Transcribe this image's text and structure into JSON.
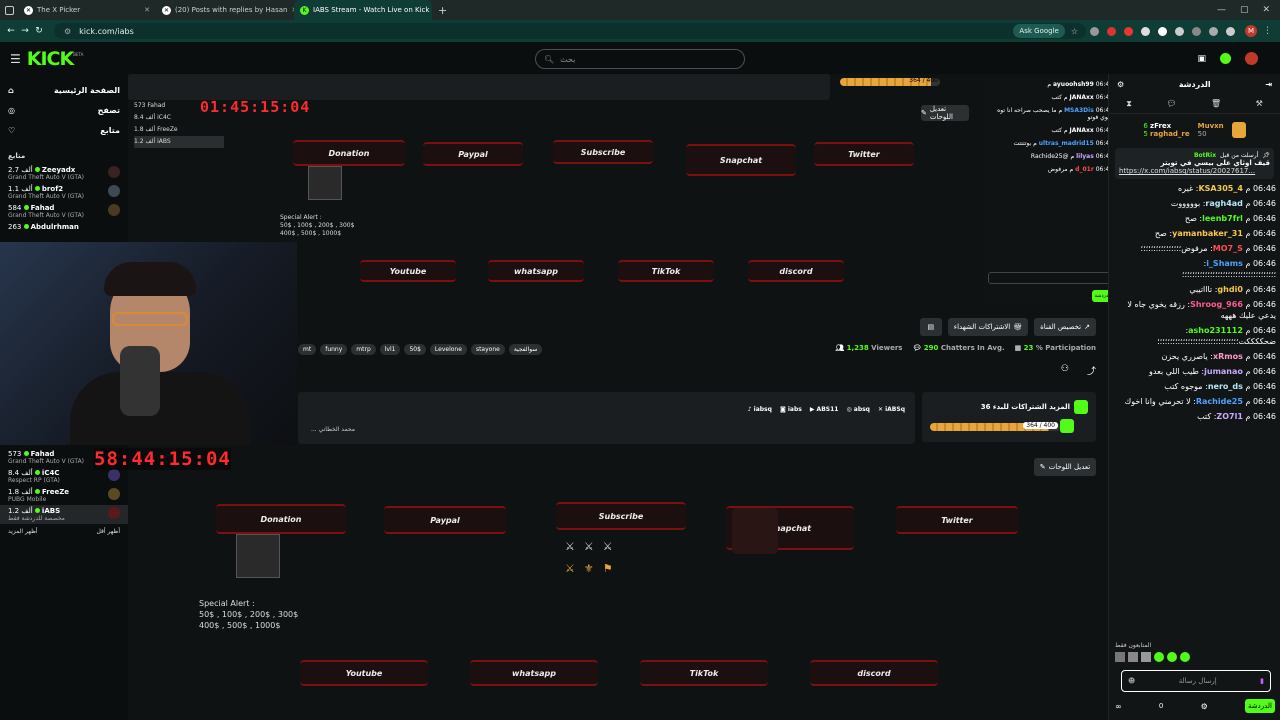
{
  "browser": {
    "tabs": [
      {
        "title": "The X Picker",
        "icon": "x-logo-icon"
      },
      {
        "title": "(20) Posts with replies by Hasan",
        "icon": "x-logo-icon"
      },
      {
        "title": "IABS Stream - Watch Live on Kick",
        "icon": "kick-icon"
      }
    ],
    "new_tab": "+",
    "url": "kick.com/iabs",
    "ask_google": "Ask Google",
    "profile_initial": "M"
  },
  "header": {
    "logo": "KICK",
    "beta": "BETA",
    "search_placeholder": "بحث"
  },
  "sidebar": {
    "nav": [
      {
        "label": "الصفحة الرئيسية",
        "icon": "home-icon"
      },
      {
        "label": "تصفح",
        "icon": "compass-icon"
      },
      {
        "label": "متابع",
        "icon": "heart-icon"
      }
    ],
    "following_heading": "متابع",
    "channels": [
      {
        "name": "Zeeyadx",
        "viewers": "2.7 ألف",
        "game": "Grand Theft Auto V (GTA)"
      },
      {
        "name": "brof2",
        "viewers": "1.1 ألف",
        "game": "Grand Theft Auto V (GTA)"
      },
      {
        "name": "Fahad",
        "viewers": "584",
        "game": "Grand Theft Auto V (GTA)"
      },
      {
        "name": "Abdulrhman",
        "viewers": "263",
        "game": ""
      }
    ],
    "channels_lower": [
      {
        "name": "Fahad",
        "viewers": "573",
        "game": "Grand Theft Auto V (GTA)"
      },
      {
        "name": "iC4C",
        "viewers": "8.4 ألف",
        "game": "Respect RP (GTA)"
      },
      {
        "name": "FreeZe",
        "viewers": "1.8 ألف",
        "game": "PUBG Mobile"
      },
      {
        "name": "iABS",
        "viewers": "1.2 ألف",
        "game": "مخصصة للدردشة فقط"
      }
    ],
    "show_more": "أظهر المزيد",
    "show_less": "أظهر أقل"
  },
  "stream": {
    "timer_top": "01:45:15:04",
    "timer_bottom": "58:44:15:04",
    "top_socials": [
      "Donation",
      "Paypal",
      "Subscribe",
      "Snapchat",
      "Twitter"
    ],
    "bottom_socials": [
      "Youtube",
      "whatsapp",
      "TikTok",
      "discord"
    ],
    "special_alert_title": "Special Alert :",
    "special_alert_line1": "50$ , 100$ , 200$ , 300$",
    "special_alert_line2": "400$ , 500$ , 1000$",
    "edit_panels": "تعديل اللوحات",
    "tags": [
      "mt",
      "funny",
      "mtrp",
      "lvl1",
      "50$",
      "Levelone",
      "stayone",
      "سوالفجية"
    ],
    "viewers_count": "1,238",
    "viewers_label": "Viewers",
    "chatters_count": "290",
    "chatters_label": "Chatters In Avg.",
    "participation": "23",
    "participation_label": "% Participation",
    "customize_button": "تخصيص القناة",
    "subscriptions_button": "الاشتراكات الشهداء",
    "links": [
      "iABSq",
      "absq",
      "ABS11",
      "iabs",
      "iabsq"
    ],
    "bio_text": "... محمد الخطاني",
    "sub_goal_title": "المزيد الشتراكات للبدء 36",
    "sub_goal_progress": "364 / 400",
    "sub_goal_fraction": 0.91
  },
  "chat": {
    "title": "الدردشة",
    "leaderboard": [
      {
        "name": "Muvxn",
        "points": "50"
      },
      {
        "name": "zFrex",
        "points": "6"
      },
      {
        "name": "raghad_re",
        "points": "5"
      }
    ],
    "pinned_author": "BotRix",
    "pinned_label": "أرسلت من قبل",
    "pinned_text": "قيف اوثاي على بيسي في تويتر",
    "pinned_link": "https://x.com/iabsq/status/20027617...",
    "messages": [
      {
        "time": "06:46 م",
        "user": "KSA305_4",
        "text": "غيره",
        "color": "#f7c948"
      },
      {
        "time": "06:46 م",
        "user": "ragh4ad",
        "text": "بوووووت",
        "color": "#b5e8f7"
      },
      {
        "time": "06:46 م",
        "user": "leenb7frl",
        "text": "صح",
        "color": "#53fc18"
      },
      {
        "time": "06:46 م",
        "user": "yamanbaker_31",
        "text": "صح",
        "color": "#f7c948"
      },
      {
        "time": "06:46 م",
        "user": "MO7_S",
        "text": "مرفوض؛؛؛؛؛؛؛؛؛؛؛؛؛؛؛؛",
        "color": "#ff4d4d"
      },
      {
        "time": "06:46 م",
        "user": "i_Shams",
        "text": "؛؛؛؛؛؛؛؛؛؛؛؛؛؛؛؛؛؛؛؛؛؛؛؛؛؛؛؛؛؛؛؛؛؛؛؛؛",
        "color": "#4da3ff"
      },
      {
        "time": "06:46 م",
        "user": "ghdi0",
        "text": "تاااتيبي",
        "color": "#f7c948"
      },
      {
        "time": "06:46 م",
        "user": "Shroog_966",
        "text": "رزقه يخوي جاه لا يدعي عليك هههه",
        "color": "#ff5c8a"
      },
      {
        "time": "06:46 م",
        "user": "asho231112",
        "text": "ضحككككت؛؛؛؛؛؛؛؛؛؛؛؛؛؛؛؛؛؛؛؛؛؛؛؛؛؛؛؛؛؛؛؛",
        "color": "#53fc18"
      },
      {
        "time": "06:46 م",
        "user": "xRmos",
        "text": "ياصرري يحزن",
        "color": "#ff99cc"
      },
      {
        "time": "06:46 م",
        "user": "jumanao",
        "text": "طيب اللي بعدو",
        "color": "#c9a8ff"
      },
      {
        "time": "06:46 م",
        "user": "nero_ds",
        "text": "موجوه كتب",
        "color": "#b5e8f7"
      },
      {
        "time": "06:46 م",
        "user": "Rachide25",
        "text": "لا تحرمني وانا اخوك",
        "color": "#4da3ff"
      },
      {
        "time": "06:46 م",
        "user": "ZO7l1",
        "text": "كتب",
        "color": "#c9a8ff"
      }
    ],
    "mini_messages": [
      {
        "time": "06:46 م",
        "user": "ayuoohsh99",
        "text": ""
      },
      {
        "time": "06:46 م",
        "user": "JANAxx",
        "text": "كتب"
      },
      {
        "time": "06:46 م",
        "user": "MSA3Dis",
        "text": "ما يصحب صراحه انا توه سوي فوتو"
      },
      {
        "time": "06:46 م",
        "user": "JANAxx",
        "text": "كتب"
      },
      {
        "time": "06:46 م",
        "user": "ultras_madrid15",
        "text": "بوتتتتت"
      },
      {
        "time": "06:46 م",
        "user": "lilyas",
        "text": "@Rachide25"
      },
      {
        "time": "06:46 م",
        "user": "d_01r",
        "text": "مرفوض"
      }
    ],
    "supporters_label": "المتابعون فقط",
    "input_placeholder": "إرسال رسالة",
    "send_button": "الدردشة"
  }
}
